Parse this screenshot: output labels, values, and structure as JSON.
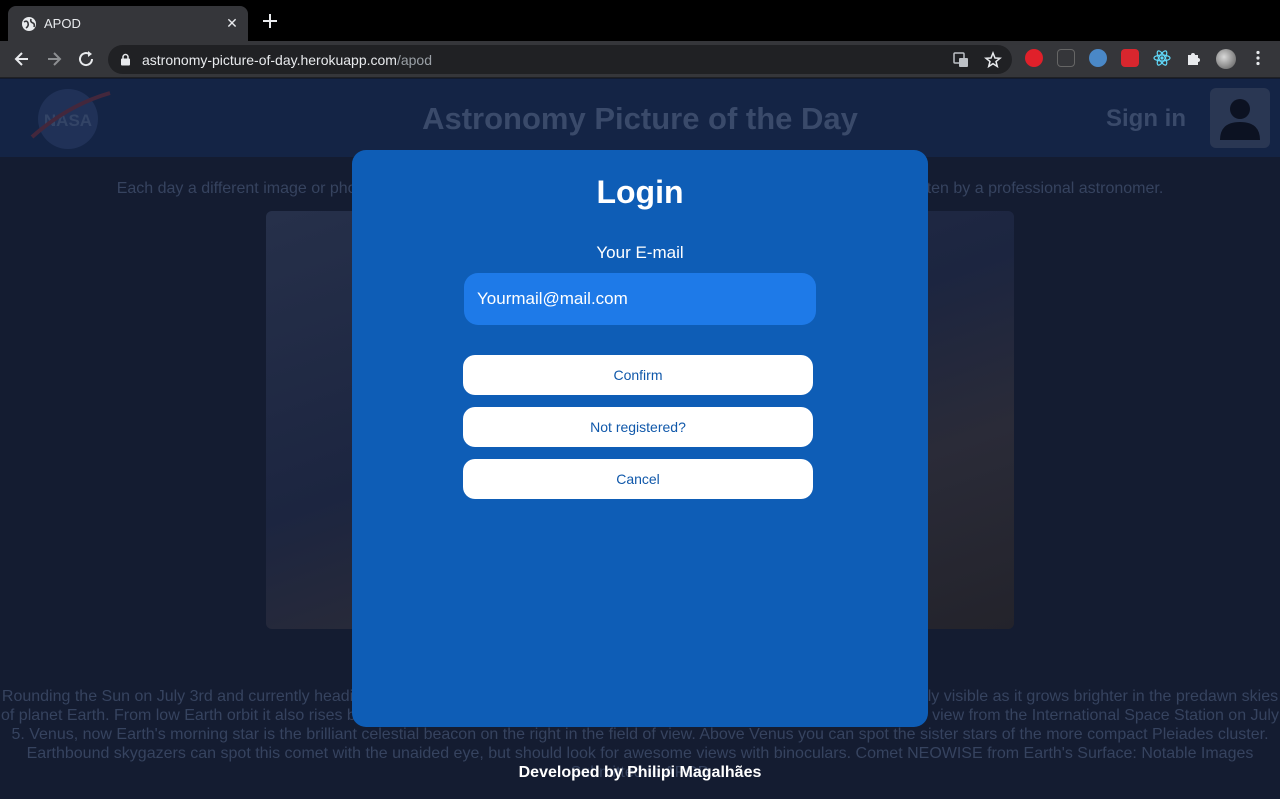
{
  "browser": {
    "tab_title": "APOD",
    "tab_close_label": "✕",
    "url_host": "astronomy-picture-of-day.herokuapp.com",
    "url_path": "/apod"
  },
  "site": {
    "title": "Astronomy Picture of the Day",
    "signin_label": "Sign in",
    "subtitle": "Each day a different image or photograph of our fascinating universe is featured, along with a brief explanation written by a professional astronomer.",
    "explanation": "Rounding the Sun on July 3rd and currently heading out of the inner solar system, Comet NEOWISE (C/2020 F3) has become easily visible as it grows brighter in the predawn skies of planet Earth. From low Earth orbit it also rises before the Sun, captured in this image with its gorgeous tails streaming across the view from the International Space Station on July 5. Venus, now Earth's morning star is the brilliant celestial beacon on the right in the field of view. Above Venus you can spot the sister stars of the more compact Pleiades cluster. Earthbound skygazers can spot this comet with the unaided eye, but should look for awesome views with binoculars. Comet NEOWISE from Earth's Surface: Notable Images Submitted to APOD",
    "footer": "Developed by Philipi Magalhães"
  },
  "modal": {
    "title": "Login",
    "email_label": "Your E-mail",
    "email_placeholder": "Yourmail@mail.com",
    "confirm_label": "Confirm",
    "register_label": "Not registered?",
    "cancel_label": "Cancel"
  },
  "icons": {
    "tab_favicon": "globe-icon",
    "new_tab": "plus-icon",
    "back": "arrow-left-icon",
    "forward": "arrow-right-icon",
    "reload": "reload-icon",
    "secure": "lock-icon",
    "translate": "translate-icon",
    "bookmark": "star-icon",
    "extensions": "puzzle-icon",
    "menu": "kebab-menu-icon",
    "account": "user-icon"
  },
  "colors": {
    "modal_bg": "#0e5db6",
    "input_bg": "#1e7ae8",
    "button_text": "#1058aa",
    "page_bg": "#141c31"
  }
}
